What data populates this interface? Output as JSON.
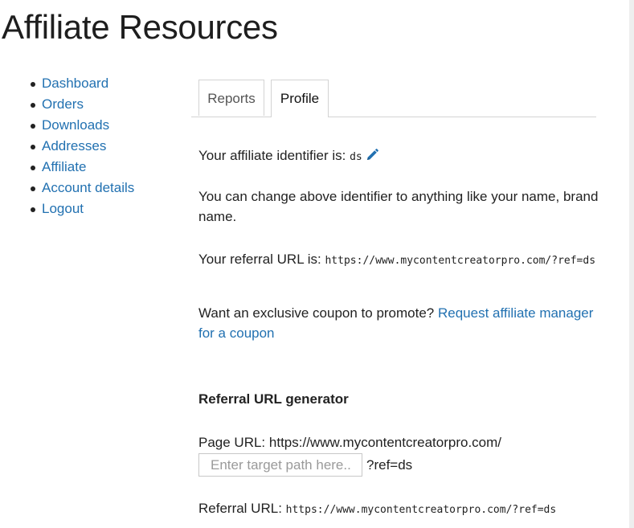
{
  "page": {
    "title": "Affiliate Resources"
  },
  "nav": {
    "items": [
      {
        "label": "Dashboard"
      },
      {
        "label": "Orders"
      },
      {
        "label": "Downloads"
      },
      {
        "label": "Addresses"
      },
      {
        "label": "Affiliate"
      },
      {
        "label": "Account details"
      },
      {
        "label": "Logout"
      }
    ]
  },
  "tabs": [
    {
      "label": "Reports",
      "active": false
    },
    {
      "label": "Profile",
      "active": true
    }
  ],
  "profile": {
    "identifier_label": "Your affiliate identifier is:",
    "identifier_value": "ds",
    "identifier_hint": "You can change above identifier to anything like your name, brand name.",
    "referral_label": "Your referral URL is:",
    "referral_url": "https://www.mycontentcreatorpro.com/?ref=ds",
    "coupon_text": "Want an exclusive coupon to promote?",
    "coupon_link": "Request affiliate manager for a coupon"
  },
  "generator": {
    "title": "Referral URL generator",
    "page_url_label": "Page URL:",
    "page_url_value": "https://www.mycontentcreatorpro.com/",
    "input_placeholder": "Enter target path here..",
    "input_value": "",
    "ref_suffix": "?ref=ds",
    "result_label": "Referral URL:",
    "result_value": "https://www.mycontentcreatorpro.com/?ref=ds"
  },
  "icons": {
    "edit": "pencil-icon"
  },
  "colors": {
    "link": "#2271b1",
    "text": "#222222",
    "border": "#d3d3d3"
  }
}
